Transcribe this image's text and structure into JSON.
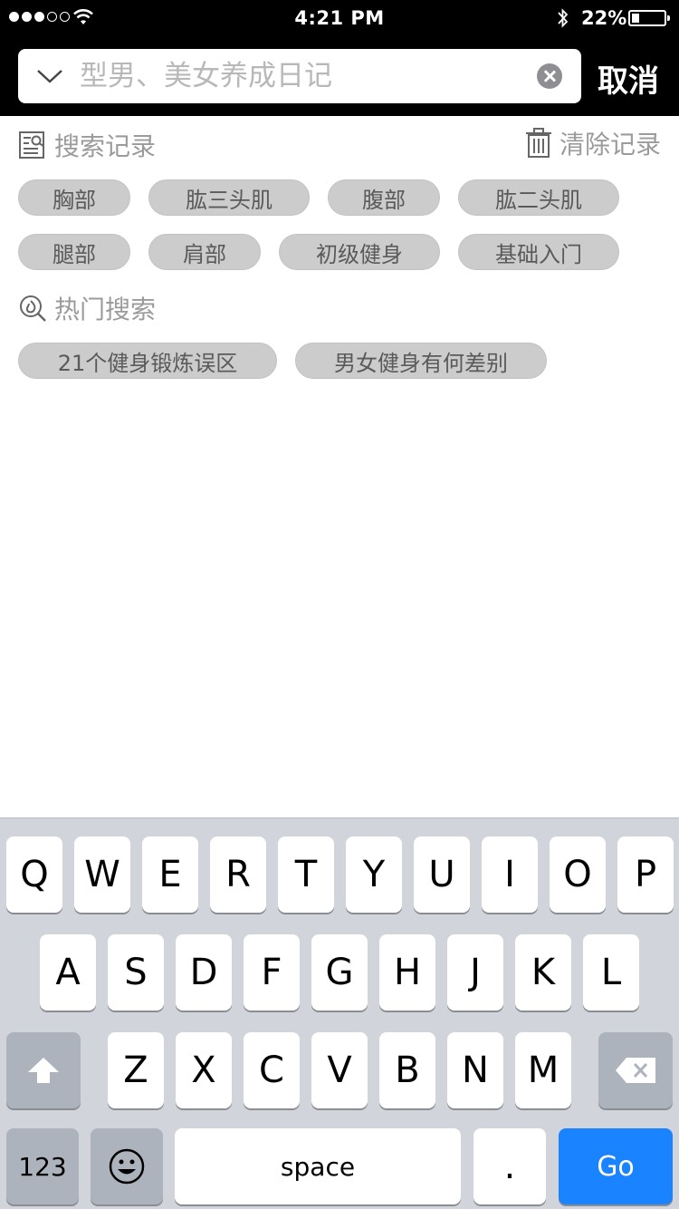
{
  "status_bar": {
    "time": "4:21 PM",
    "battery": "22%",
    "signal_bars": 3
  },
  "search": {
    "placeholder": "型男、美女养成日记",
    "cancel_label": "取消"
  },
  "history": {
    "title": "搜索记录",
    "clear_label": "清除记录",
    "tags": [
      "胸部",
      "肱三头肌",
      "腹部",
      "肱二头肌",
      "腿部",
      "肩部",
      "初级健身",
      "基础入门"
    ]
  },
  "hot": {
    "title": "热门搜索",
    "tags": [
      "21个健身锻炼误区",
      "男女健身有何差别"
    ]
  },
  "keyboard": {
    "row1": [
      "Q",
      "W",
      "E",
      "R",
      "T",
      "Y",
      "U",
      "I",
      "O",
      "P"
    ],
    "row2": [
      "A",
      "S",
      "D",
      "F",
      "G",
      "H",
      "J",
      "K",
      "L"
    ],
    "row3": [
      "Z",
      "X",
      "C",
      "V",
      "B",
      "N",
      "M"
    ],
    "numbers_label": "123",
    "space_label": "space",
    "period_label": ".",
    "go_label": "Go",
    "accent_color": "#1a83ff"
  }
}
